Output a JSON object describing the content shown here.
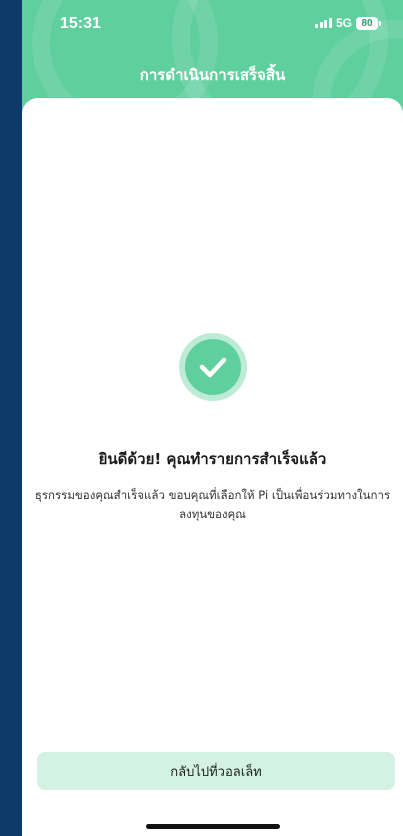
{
  "status_bar": {
    "time": "15:31",
    "network": "5G",
    "battery": "80"
  },
  "header": {
    "title": "การดำเนินการเสร็จสิ้น"
  },
  "result": {
    "icon": "check-circle-icon",
    "title": "ยินดีด้วย! คุณทำรายการสำเร็จแล้ว",
    "description": "ธุรกรรมของคุณสำเร็จแล้ว ขอบคุณที่เลือกให้ Pi เป็นเพื่อนร่วมทางในการลงทุนของคุณ"
  },
  "actions": {
    "back_to_wallet": "กลับไปที่วอลเล็ท"
  },
  "colors": {
    "primary": "#5fcf9e",
    "button_bg": "#d3f2e4",
    "page_bg": "#0d3c6b"
  }
}
